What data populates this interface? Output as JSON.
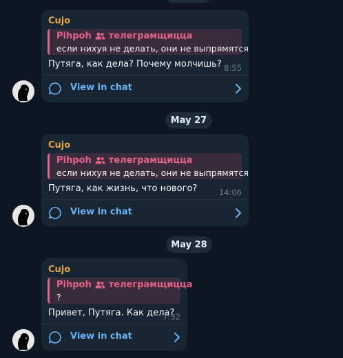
{
  "messages": [
    {
      "sender": "Cujo",
      "reply_author": "Pihpoh",
      "reply_group": "телеграмщицца",
      "reply_text": "если нихуя не делать, они не выпрямятся",
      "text": "Путяга, как дела? Почему молчишь?",
      "time": "8:55",
      "view_label": "View in chat"
    },
    {
      "date": "May 27",
      "sender": "Cujo",
      "reply_author": "Pihpoh",
      "reply_group": "телеграмщицца",
      "reply_text": "если нихуя не делать, они не выпрямятся",
      "text": "Путяга, как жизнь, что нового?",
      "time": "14:06",
      "view_label": "View in chat"
    },
    {
      "date": "May 28",
      "sender": "Cujo",
      "reply_author": "Pihpoh",
      "reply_group": "телеграмщицца",
      "reply_text": "?",
      "text": "Привет, Путяга. Как дела?",
      "time": "7:32",
      "view_label": "View in chat"
    }
  ],
  "colors": {
    "background": "#0e1621",
    "bubble": "#182533",
    "sender": "#e5a64a",
    "reply_accent": "#e4628a",
    "link": "#6ab3f3"
  },
  "icons": {
    "reply_group": "group-icon",
    "view": "chat-bubble-icon",
    "go": "chevron-right-icon"
  }
}
